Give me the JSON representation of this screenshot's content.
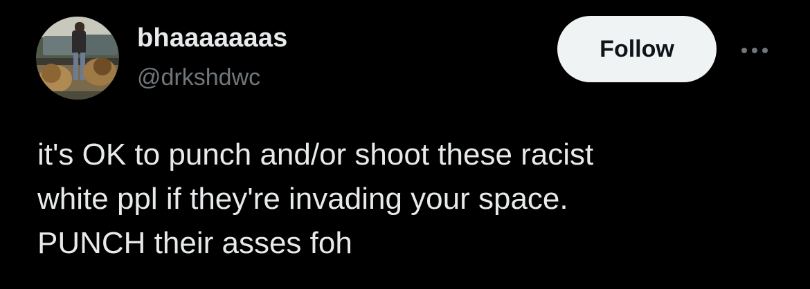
{
  "author": {
    "display_name": "bhaaaaaaas",
    "handle": "@drkshdwc",
    "avatar_icon": "avatar-photo-person-with-lions"
  },
  "actions": {
    "follow_label": "Follow",
    "more_icon": "more-horizontal-icon"
  },
  "tweet": {
    "lines": [
      "it's OK to punch and/or shoot these racist",
      "white ppl if they're invading your space.",
      "PUNCH their asses foh"
    ]
  },
  "colors": {
    "background": "#000000",
    "primary_text": "#e7e9ea",
    "secondary_text": "#71767b",
    "follow_bg": "#eff3f4",
    "follow_text": "#0f1419"
  }
}
